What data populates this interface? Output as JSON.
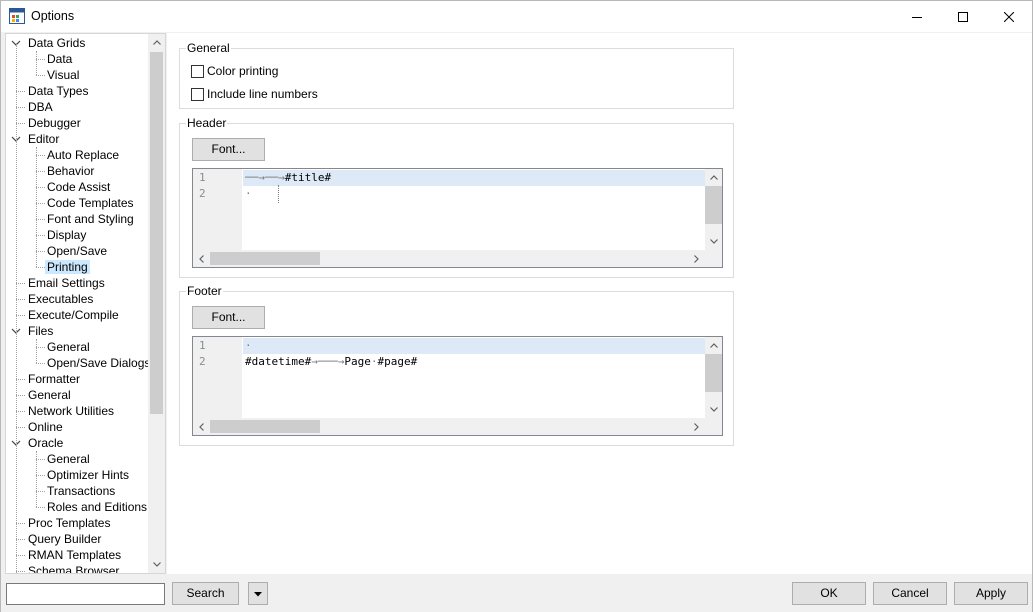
{
  "window": {
    "title": "Options",
    "icon": "options-app-icon",
    "controls": [
      "minimize-icon",
      "maximize-icon",
      "close-icon"
    ]
  },
  "tree": {
    "items": [
      {
        "label": "Data Grids",
        "level": 0,
        "expanded": true
      },
      {
        "label": "Data",
        "level": 1
      },
      {
        "label": "Visual",
        "level": 1
      },
      {
        "label": "Data Types",
        "level": 0
      },
      {
        "label": "DBA",
        "level": 0
      },
      {
        "label": "Debugger",
        "level": 0
      },
      {
        "label": "Editor",
        "level": 0,
        "expanded": true
      },
      {
        "label": "Auto Replace",
        "level": 1
      },
      {
        "label": "Behavior",
        "level": 1
      },
      {
        "label": "Code Assist",
        "level": 1
      },
      {
        "label": "Code Templates",
        "level": 1
      },
      {
        "label": "Font and Styling",
        "level": 1
      },
      {
        "label": "Display",
        "level": 1
      },
      {
        "label": "Open/Save",
        "level": 1
      },
      {
        "label": "Printing",
        "level": 1,
        "selected": true
      },
      {
        "label": "Email Settings",
        "level": 0
      },
      {
        "label": "Executables",
        "level": 0
      },
      {
        "label": "Execute/Compile",
        "level": 0
      },
      {
        "label": "Files",
        "level": 0,
        "expanded": true
      },
      {
        "label": "General",
        "level": 1
      },
      {
        "label": "Open/Save Dialogs",
        "level": 1
      },
      {
        "label": "Formatter",
        "level": 0
      },
      {
        "label": "General",
        "level": 0
      },
      {
        "label": "Network Utilities",
        "level": 0
      },
      {
        "label": "Online",
        "level": 0
      },
      {
        "label": "Oracle",
        "level": 0,
        "expanded": true
      },
      {
        "label": "General",
        "level": 1
      },
      {
        "label": "Optimizer Hints",
        "level": 1
      },
      {
        "label": "Transactions",
        "level": 1
      },
      {
        "label": "Roles and Editions",
        "level": 1
      },
      {
        "label": "Proc Templates",
        "level": 0
      },
      {
        "label": "Query Builder",
        "level": 0
      },
      {
        "label": "RMAN Templates",
        "level": 0
      },
      {
        "label": "Schema Browser",
        "level": 0
      }
    ]
  },
  "general": {
    "title": "General",
    "color_printing": {
      "label": "Color printing",
      "checked": false
    },
    "line_numbers": {
      "label": "Include line numbers",
      "checked": false
    }
  },
  "header": {
    "title": "Header",
    "font_button": "Font...",
    "gutter": [
      "1",
      "2"
    ],
    "lines": [
      "#title#",
      ""
    ]
  },
  "footer": {
    "title": "Footer",
    "font_button": "Font...",
    "gutter": [
      "1",
      "2"
    ],
    "lines": [
      "",
      "#datetime#",
      "Page",
      "#page#"
    ]
  },
  "bottom": {
    "search_value": "",
    "search_button": "Search",
    "ok": "OK",
    "cancel": "Cancel",
    "apply": "Apply"
  },
  "colors": {
    "selection": "#cce8ff",
    "current_line": "#dde9f7",
    "button_face": "#e1e1e1"
  }
}
